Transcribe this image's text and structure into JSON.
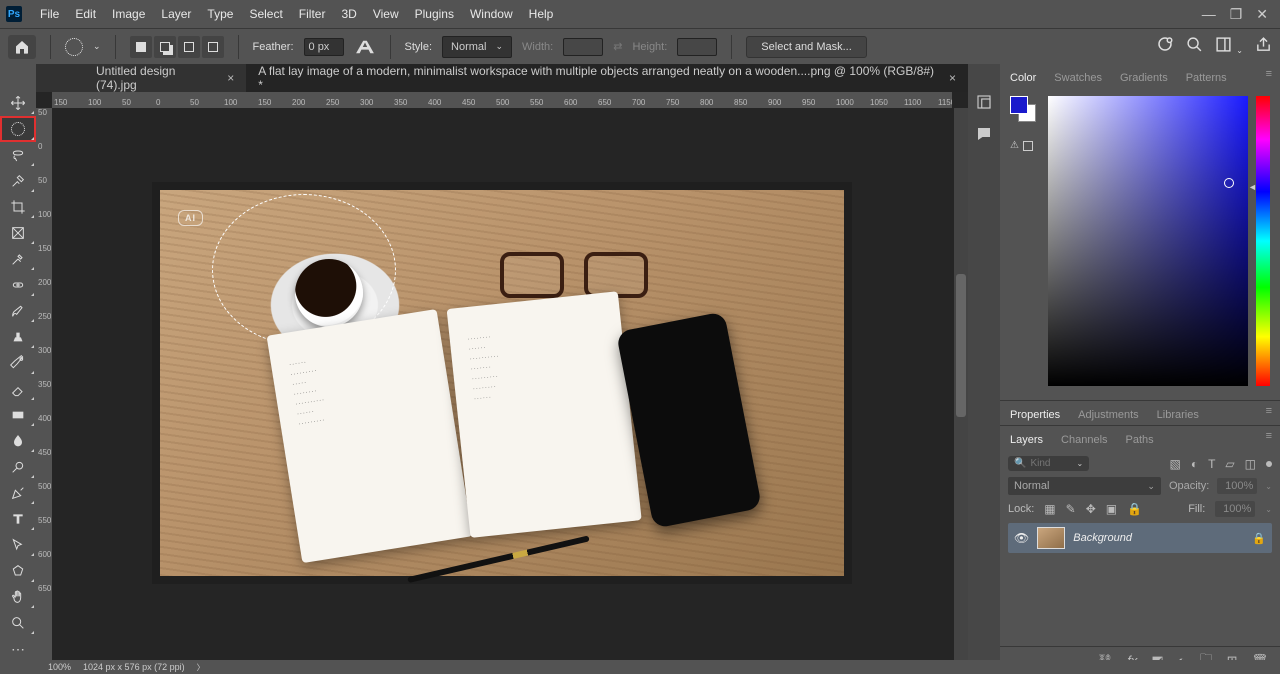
{
  "menu": {
    "items": [
      "File",
      "Edit",
      "Image",
      "Layer",
      "Type",
      "Select",
      "Filter",
      "3D",
      "View",
      "Plugins",
      "Window",
      "Help"
    ]
  },
  "options": {
    "feather_label": "Feather:",
    "feather_value": "0 px",
    "antialias_label": "Anti-alias",
    "style_label": "Style:",
    "style_value": "Normal",
    "width_label": "Width:",
    "height_label": "Height:",
    "select_mask": "Select and Mask..."
  },
  "tabs": [
    {
      "label": "Untitled design (74).jpg",
      "active": false
    },
    {
      "label": "A flat lay image of a modern, minimalist workspace with multiple objects arranged neatly on a wooden....png @ 100% (RGB/8#) *",
      "active": true
    }
  ],
  "ruler_h": [
    "150",
    "100",
    "50",
    "0",
    "50",
    "100",
    "150",
    "200",
    "250",
    "300",
    "350",
    "400",
    "450",
    "500",
    "550",
    "600",
    "650",
    "700",
    "750",
    "800",
    "850",
    "900",
    "950",
    "1000",
    "1050",
    "1100",
    "1150"
  ],
  "ruler_v": [
    "50",
    "0",
    "50",
    "100",
    "150",
    "200",
    "250",
    "300",
    "350",
    "400",
    "450",
    "500",
    "550",
    "600",
    "650"
  ],
  "status": {
    "zoom": "100%",
    "info": "1024 px x 576 px (72 ppi)"
  },
  "color_tabs": [
    "Color",
    "Swatches",
    "Gradients",
    "Patterns"
  ],
  "color": {
    "fg": "#1a1acc",
    "bg": "#ffffff"
  },
  "props_tabs": [
    "Properties",
    "Adjustments",
    "Libraries"
  ],
  "layer_tabs": [
    "Layers",
    "Channels",
    "Paths"
  ],
  "layers": {
    "kind_placeholder": "Kind",
    "blend": "Normal",
    "opacity_label": "Opacity:",
    "opacity_value": "100%",
    "lock_label": "Lock:",
    "fill_label": "Fill:",
    "fill_value": "100%",
    "items": [
      {
        "name": "Background",
        "locked": true,
        "visible": true
      }
    ]
  },
  "ai_tag": "AI"
}
